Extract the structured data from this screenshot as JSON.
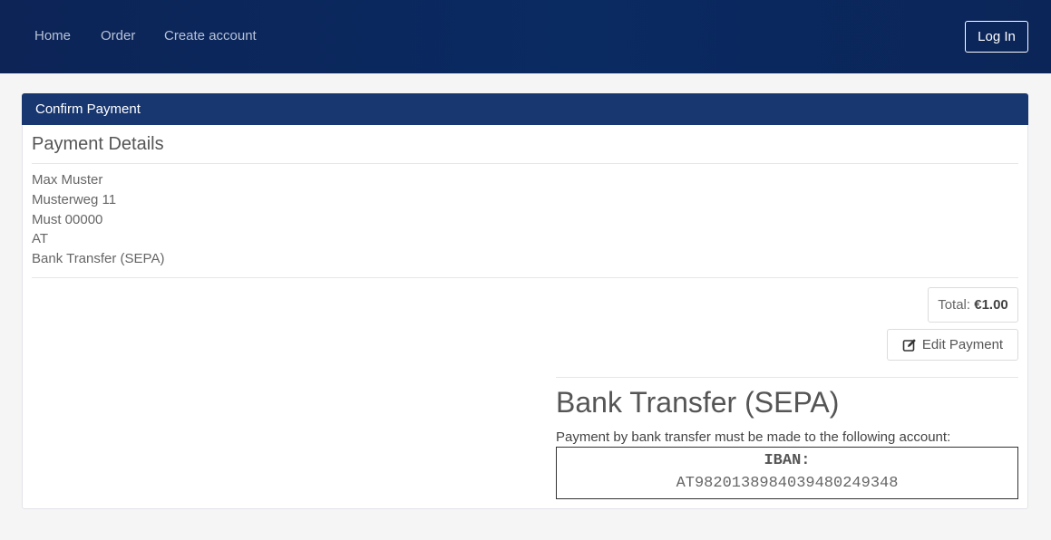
{
  "nav": {
    "links": [
      "Home",
      "Order",
      "Create account"
    ],
    "login_label": "Log In"
  },
  "card": {
    "header": "Confirm Payment",
    "details_title": "Payment Details",
    "address_lines": [
      "Max Muster",
      "Musterweg 11",
      "Must 00000",
      "AT",
      "Bank Transfer (SEPA)"
    ],
    "total_label": "Total:",
    "total_value": "€1.00",
    "edit_label": "Edit Payment",
    "edit_icon": "edit-icon"
  },
  "payment": {
    "method_title": "Bank Transfer (SEPA)",
    "instruction": "Payment by bank transfer must be made to the following account:",
    "iban_label": "IBAN:",
    "iban_value": "AT982013898403948024934​8"
  },
  "colors": {
    "navbar": "#0c2456",
    "card_header": "#183770",
    "background": "#f5f5f5"
  }
}
